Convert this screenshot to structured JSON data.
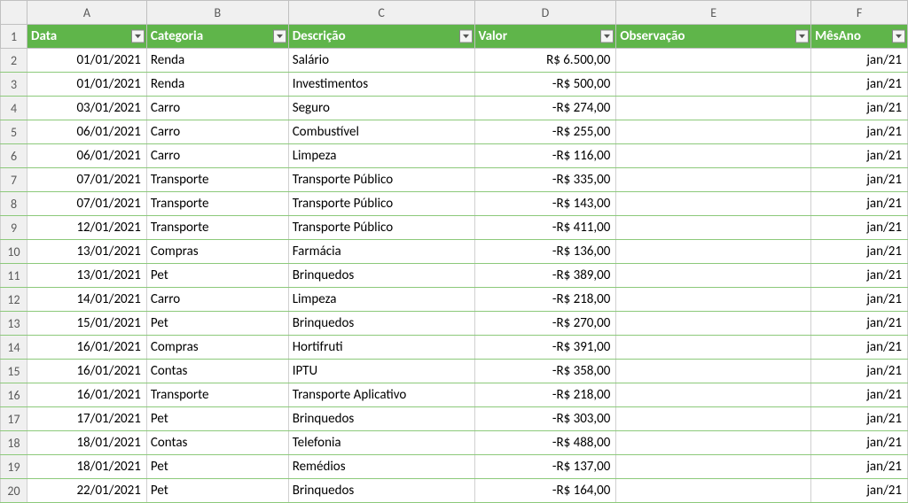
{
  "columns": [
    "A",
    "B",
    "C",
    "D",
    "E",
    "F"
  ],
  "row_numbers": [
    "1",
    "2",
    "3",
    "4",
    "5",
    "6",
    "7",
    "8",
    "9",
    "10",
    "11",
    "12",
    "13",
    "14",
    "15",
    "16",
    "17",
    "18",
    "19",
    "20"
  ],
  "headers": {
    "data": "Data",
    "categoria": "Categoria",
    "descricao": "Descrição",
    "valor": "Valor",
    "observacao": "Observação",
    "mesano": "MêsAno"
  },
  "rows": [
    {
      "data": "01/01/2021",
      "categoria": "Renda",
      "descricao": "Salário",
      "valor": "R$ 6.500,00",
      "observacao": "",
      "mesano": "jan/21"
    },
    {
      "data": "01/01/2021",
      "categoria": "Renda",
      "descricao": "Investimentos",
      "valor": "-R$ 500,00",
      "observacao": "",
      "mesano": "jan/21"
    },
    {
      "data": "03/01/2021",
      "categoria": "Carro",
      "descricao": "Seguro",
      "valor": "-R$ 274,00",
      "observacao": "",
      "mesano": "jan/21"
    },
    {
      "data": "06/01/2021",
      "categoria": "Carro",
      "descricao": "Combustível",
      "valor": "-R$ 255,00",
      "observacao": "",
      "mesano": "jan/21"
    },
    {
      "data": "06/01/2021",
      "categoria": "Carro",
      "descricao": "Limpeza",
      "valor": "-R$ 116,00",
      "observacao": "",
      "mesano": "jan/21"
    },
    {
      "data": "07/01/2021",
      "categoria": "Transporte",
      "descricao": "Transporte Público",
      "valor": "-R$ 335,00",
      "observacao": "",
      "mesano": "jan/21"
    },
    {
      "data": "07/01/2021",
      "categoria": "Transporte",
      "descricao": "Transporte Público",
      "valor": "-R$ 143,00",
      "observacao": "",
      "mesano": "jan/21"
    },
    {
      "data": "12/01/2021",
      "categoria": "Transporte",
      "descricao": "Transporte Público",
      "valor": "-R$ 411,00",
      "observacao": "",
      "mesano": "jan/21"
    },
    {
      "data": "13/01/2021",
      "categoria": "Compras",
      "descricao": "Farmácia",
      "valor": "-R$ 136,00",
      "observacao": "",
      "mesano": "jan/21"
    },
    {
      "data": "13/01/2021",
      "categoria": "Pet",
      "descricao": "Brinquedos",
      "valor": "-R$ 389,00",
      "observacao": "",
      "mesano": "jan/21"
    },
    {
      "data": "14/01/2021",
      "categoria": "Carro",
      "descricao": "Limpeza",
      "valor": "-R$ 218,00",
      "observacao": "",
      "mesano": "jan/21"
    },
    {
      "data": "15/01/2021",
      "categoria": "Pet",
      "descricao": "Brinquedos",
      "valor": "-R$ 270,00",
      "observacao": "",
      "mesano": "jan/21"
    },
    {
      "data": "16/01/2021",
      "categoria": "Compras",
      "descricao": "Hortifruti",
      "valor": "-R$ 391,00",
      "observacao": "",
      "mesano": "jan/21"
    },
    {
      "data": "16/01/2021",
      "categoria": "Contas",
      "descricao": "IPTU",
      "valor": "-R$ 358,00",
      "observacao": "",
      "mesano": "jan/21"
    },
    {
      "data": "16/01/2021",
      "categoria": "Transporte",
      "descricao": "Transporte Aplicativo",
      "valor": "-R$ 218,00",
      "observacao": "",
      "mesano": "jan/21"
    },
    {
      "data": "17/01/2021",
      "categoria": "Pet",
      "descricao": "Brinquedos",
      "valor": "-R$ 303,00",
      "observacao": "",
      "mesano": "jan/21"
    },
    {
      "data": "18/01/2021",
      "categoria": "Contas",
      "descricao": "Telefonia",
      "valor": "-R$ 488,00",
      "observacao": "",
      "mesano": "jan/21"
    },
    {
      "data": "18/01/2021",
      "categoria": "Pet",
      "descricao": "Remédios",
      "valor": "-R$ 137,00",
      "observacao": "",
      "mesano": "jan/21"
    },
    {
      "data": "22/01/2021",
      "categoria": "Pet",
      "descricao": "Brinquedos",
      "valor": "-R$ 164,00",
      "observacao": "",
      "mesano": "jan/21"
    }
  ]
}
